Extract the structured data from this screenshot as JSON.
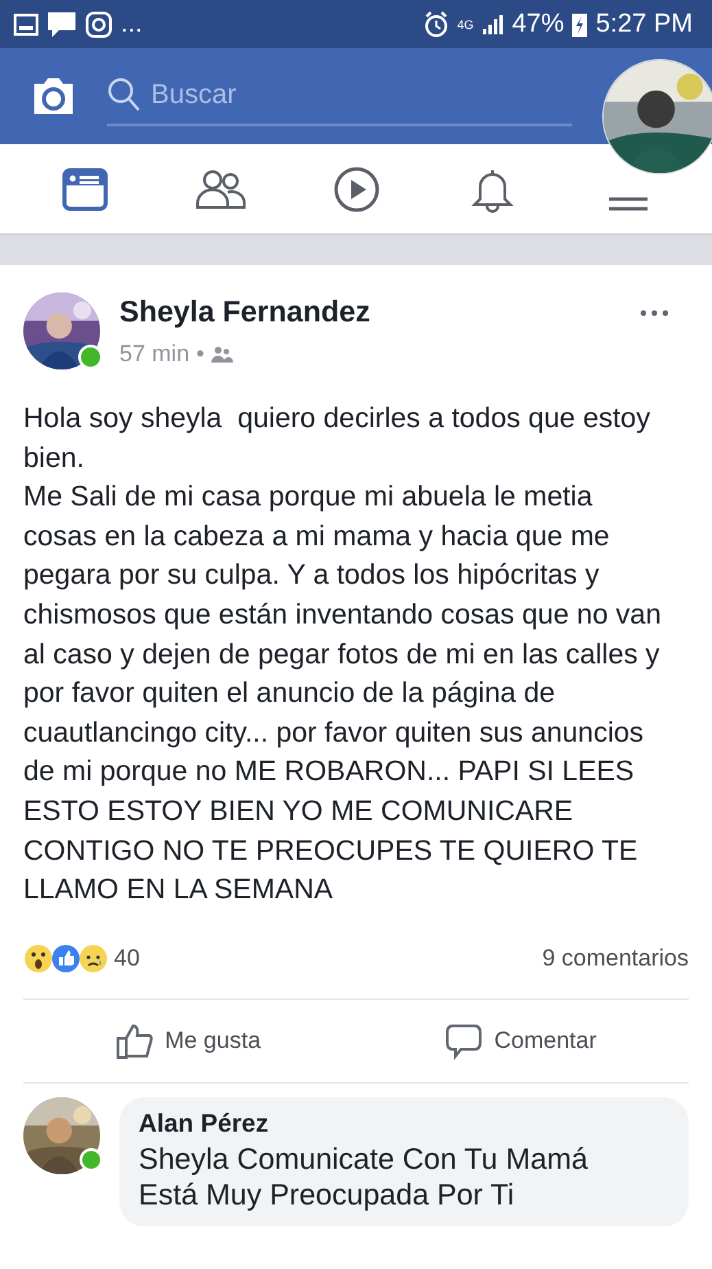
{
  "status_bar": {
    "overflow": "...",
    "network": "4G",
    "battery": "47%",
    "time": "5:27 PM"
  },
  "header": {
    "search": {
      "placeholder": "Buscar"
    }
  },
  "tabs": [
    {
      "kind": "feed",
      "selected": true
    },
    {
      "kind": "friends",
      "selected": false
    },
    {
      "kind": "video",
      "selected": false
    },
    {
      "kind": "notifications",
      "selected": false
    },
    {
      "kind": "menu",
      "selected": false
    }
  ],
  "post": {
    "author": "Sheyla Fernandez",
    "online": true,
    "time": "57 min",
    "separator": "•",
    "paragraphs": [
      "Hola soy sheyla  quiero decirles a todos que estoy bien.",
      "Me Sali de mi casa porque mi abuela le metia cosas en la cabeza a mi mama y hacia que me pegara por su culpa. Y a todos los hipócritas y chismosos que están inventando cosas que no van al caso y dejen de pegar fotos de mi en las calles y por favor quiten el anuncio de la página de cuautlancingo city... por favor quiten sus anuncios de mi porque no ME ROBARON... PAPI SI LEES ESTO ESTOY BIEN YO ME COMUNICARE CONTIGO NO TE PREOCUPES TE QUIERO TE LLAMO EN LA SEMANA"
    ],
    "reactions": [
      {
        "kind": "wow"
      },
      {
        "kind": "like"
      },
      {
        "kind": "sad"
      }
    ],
    "reaction_count": "40",
    "comment_count": "9 comentarios",
    "actions": [
      {
        "kind": "like",
        "label": "Me gusta"
      },
      {
        "kind": "comment",
        "label": "Comentar"
      }
    ]
  },
  "comments": [
    {
      "author": "Alan Pérez",
      "online": true,
      "lines": [
        "Sheyla Comunicate Con Tu Mamá",
        "Está Muy Preocupada Por Ti"
      ]
    }
  ]
}
